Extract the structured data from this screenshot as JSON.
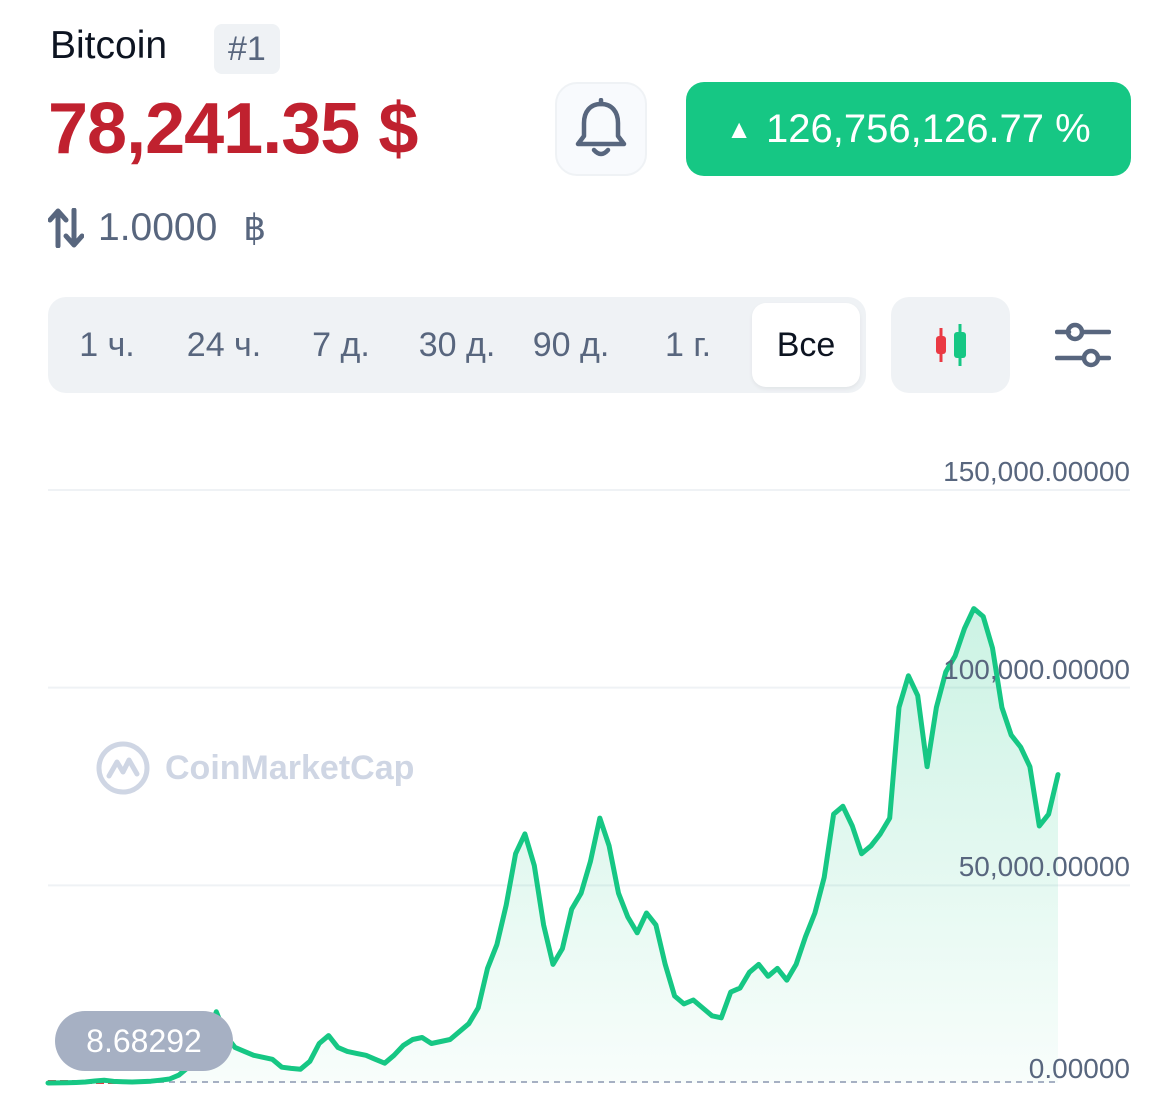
{
  "coin": {
    "name": "Bitcoin",
    "rank": "#1"
  },
  "price": {
    "value": "78,241.35 $"
  },
  "change": {
    "arrow": "▲",
    "value": "126,756,126.77 %"
  },
  "conversion": {
    "value": "1.0000",
    "symbol": "฿"
  },
  "periods": [
    {
      "label": "1 ч."
    },
    {
      "label": "24 ч."
    },
    {
      "label": "7 д."
    },
    {
      "label": "30 д."
    },
    {
      "label": "90 д."
    },
    {
      "label": "1 г."
    },
    {
      "label": "Все",
      "active": true
    }
  ],
  "watermark": {
    "text": "CoinMarketCap"
  },
  "colors": {
    "up": "#16c784",
    "down": "#ea3943",
    "price": "#c0212f",
    "grid": "#eff2f5"
  },
  "icons": {
    "bell": "bell-icon",
    "candles": "candlestick-icon",
    "settings": "sliders-icon",
    "swap": "swap-arrows-icon"
  },
  "chart_data": {
    "type": "area",
    "y_tick_labels": [
      "150,000.00000",
      "100,000.00000",
      "50,000.00000",
      "0.00000"
    ],
    "y_ticks": [
      150000,
      100000,
      50000,
      0
    ],
    "ylim": [
      0,
      150000
    ],
    "grid": true,
    "start_label": "8.68292",
    "start_value": 8.68292,
    "series": [
      {
        "values": [
          8.68,
          20,
          60,
          120,
          250,
          500,
          700,
          400,
          300,
          250,
          350,
          450,
          700,
          1000,
          2000,
          4000,
          6500,
          11000,
          18000,
          12000,
          9000,
          8000,
          7000,
          6500,
          6000,
          4000,
          3700,
          3500,
          5500,
          10000,
          12000,
          9000,
          8000,
          7500,
          7000,
          6000,
          5000,
          7000,
          9500,
          11000,
          11500,
          10000,
          10500,
          11000,
          13000,
          15000,
          19000,
          29000,
          35000,
          45000,
          58000,
          63000,
          55000,
          40000,
          30000,
          34000,
          44000,
          48000,
          56000,
          67000,
          60000,
          48000,
          42000,
          38000,
          43000,
          40000,
          30000,
          22000,
          20000,
          21000,
          19000,
          17000,
          16500,
          23000,
          24000,
          28000,
          30000,
          27000,
          29000,
          26000,
          30000,
          37000,
          43000,
          52000,
          68000,
          70000,
          65000,
          58000,
          60000,
          63000,
          67000,
          95000,
          103000,
          98000,
          80000,
          95000,
          104000,
          108000,
          115000,
          120000,
          118000,
          110000,
          95000,
          88000,
          85000,
          80000,
          65000,
          68000,
          78000
        ]
      }
    ]
  }
}
